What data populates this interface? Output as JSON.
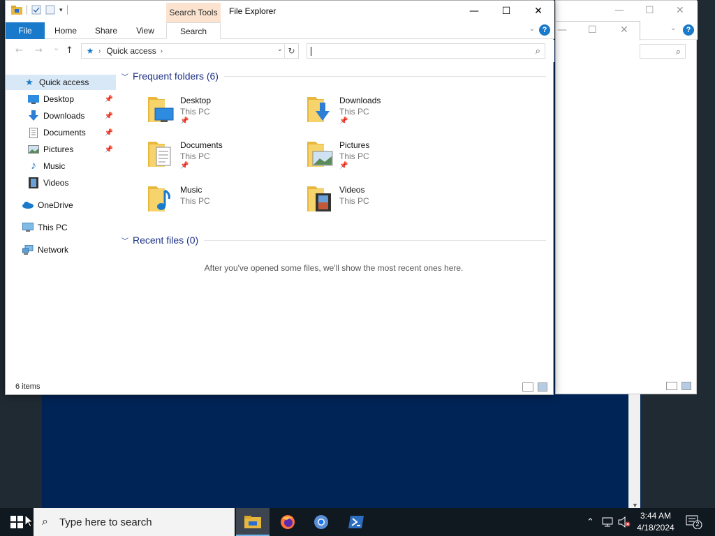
{
  "window": {
    "qat_tab_label": "Search Tools",
    "title": "File Explorer",
    "minimize": "—",
    "maximize": "☐",
    "close": "✕"
  },
  "ribbon": {
    "tabs": [
      "File",
      "Home",
      "Share",
      "View",
      "Search"
    ],
    "help": "?"
  },
  "navbar": {
    "back": "←",
    "forward": "→",
    "recent": "⌄",
    "up": "↑",
    "breadcrumb": "Quick access",
    "refresh": "↻",
    "search_placeholder": ""
  },
  "sidebar": {
    "items": [
      {
        "label": "Quick access",
        "icon": "star-icon",
        "pinned": false
      },
      {
        "label": "Desktop",
        "icon": "desktop-icon",
        "pinned": true
      },
      {
        "label": "Downloads",
        "icon": "download-icon",
        "pinned": true
      },
      {
        "label": "Documents",
        "icon": "document-icon",
        "pinned": true
      },
      {
        "label": "Pictures",
        "icon": "picture-icon",
        "pinned": true
      },
      {
        "label": "Music",
        "icon": "music-icon",
        "pinned": false
      },
      {
        "label": "Videos",
        "icon": "video-icon",
        "pinned": false
      },
      {
        "label": "OneDrive",
        "icon": "cloud-icon",
        "pinned": false
      },
      {
        "label": "This PC",
        "icon": "computer-icon",
        "pinned": false
      },
      {
        "label": "Network",
        "icon": "network-icon",
        "pinned": false
      }
    ]
  },
  "content": {
    "frequent_header": "Frequent folders (6)",
    "recent_header": "Recent files (0)",
    "empty_message": "After you've opened some files, we'll show the most recent ones here.",
    "folders": [
      {
        "name": "Desktop",
        "location": "This PC",
        "pinned": true
      },
      {
        "name": "Downloads",
        "location": "This PC",
        "pinned": true
      },
      {
        "name": "Documents",
        "location": "This PC",
        "pinned": true
      },
      {
        "name": "Pictures",
        "location": "This PC",
        "pinned": true
      },
      {
        "name": "Music",
        "location": "This PC",
        "pinned": false
      },
      {
        "name": "Videos",
        "location": "This PC",
        "pinned": false
      }
    ]
  },
  "status": {
    "item_count": "6 items"
  },
  "taskbar": {
    "search_placeholder": "Type here to search",
    "time": "3:44 AM",
    "date": "4/18/2024",
    "notification_count": "2"
  },
  "colors": {
    "accent": "#1979ca",
    "search_tools_tab": "#fbe3cf",
    "header_text": "#1e3287",
    "powershell_bg": "#012456",
    "taskbar_bg": "#101820"
  }
}
